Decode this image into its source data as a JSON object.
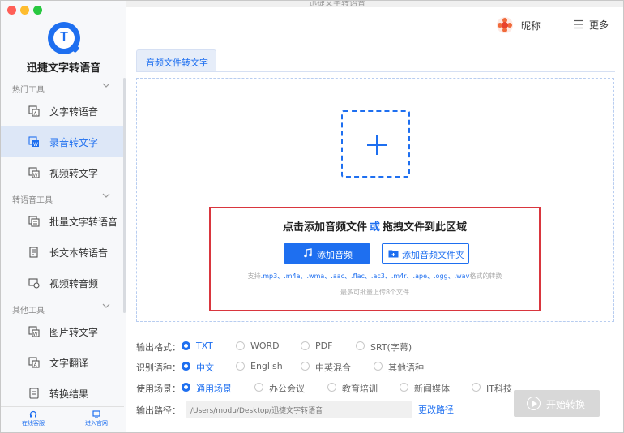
{
  "window": {
    "title_ghost": "迅捷文字转语音"
  },
  "sidebar": {
    "app_name": "迅捷文字转语音",
    "sections": [
      {
        "label": "热门工具",
        "items": [
          {
            "label": "文字转语音",
            "icon": "text-to-speech-icon",
            "active": false
          },
          {
            "label": "录音转文字",
            "icon": "recording-to-text-icon",
            "active": true
          },
          {
            "label": "视频转文字",
            "icon": "video-to-text-icon",
            "active": false
          }
        ]
      },
      {
        "label": "转语音工具",
        "items": [
          {
            "label": "批量文字转语音",
            "icon": "batch-text-icon",
            "active": false
          },
          {
            "label": "长文本转语音",
            "icon": "long-text-icon",
            "active": false
          },
          {
            "label": "视频转音频",
            "icon": "video-to-audio-icon",
            "active": false
          }
        ]
      },
      {
        "label": "其他工具",
        "items": [
          {
            "label": "图片转文字",
            "icon": "image-to-text-icon",
            "active": false
          },
          {
            "label": "文字翻译",
            "icon": "translate-icon",
            "active": false
          },
          {
            "label": "转换结果",
            "icon": "results-icon",
            "active": false
          }
        ]
      }
    ],
    "footer": {
      "support": "在线客服",
      "website": "进入官网"
    }
  },
  "header": {
    "nickname": "昵称",
    "more": "更多"
  },
  "tabs": [
    {
      "label": "音频文件转文字",
      "active": true
    }
  ],
  "dropzone": {
    "headline_left": "点击添加音频文件",
    "headline_or": "或",
    "headline_right": "拖拽文件到此区域",
    "add_audio": "添加音频",
    "add_folder": "添加音频文件夹",
    "support_prefix": "支持",
    "formats": ".mp3、.m4a、.wma、.aac、.flac、.ac3、.m4r、.ape、.ogg、.wav",
    "support_suffix": "格式的转换",
    "limit": "最多可批量上传8个文件"
  },
  "options": {
    "format": {
      "label": "输出格式：",
      "choices": [
        "TXT",
        "WORD",
        "PDF",
        "SRT(字幕)"
      ],
      "selected": 0
    },
    "language": {
      "label": "识别语种：",
      "choices": [
        "中文",
        "English",
        "中英混合",
        "其他语种"
      ],
      "selected": 0
    },
    "scene": {
      "label": "使用场景：",
      "choices": [
        "通用场景",
        "办公会议",
        "教育培训",
        "新闻媒体",
        "IT科技"
      ],
      "selected": 0
    },
    "path": {
      "label": "输出路径：",
      "value": "/Users/modu/Desktop/迅捷文字转语音",
      "change": "更改路径"
    }
  },
  "start_button": "开始转换",
  "colors": {
    "accent": "#1e6ff0",
    "highlight_border": "#d9363e",
    "disabled": "#d8d8d8"
  }
}
